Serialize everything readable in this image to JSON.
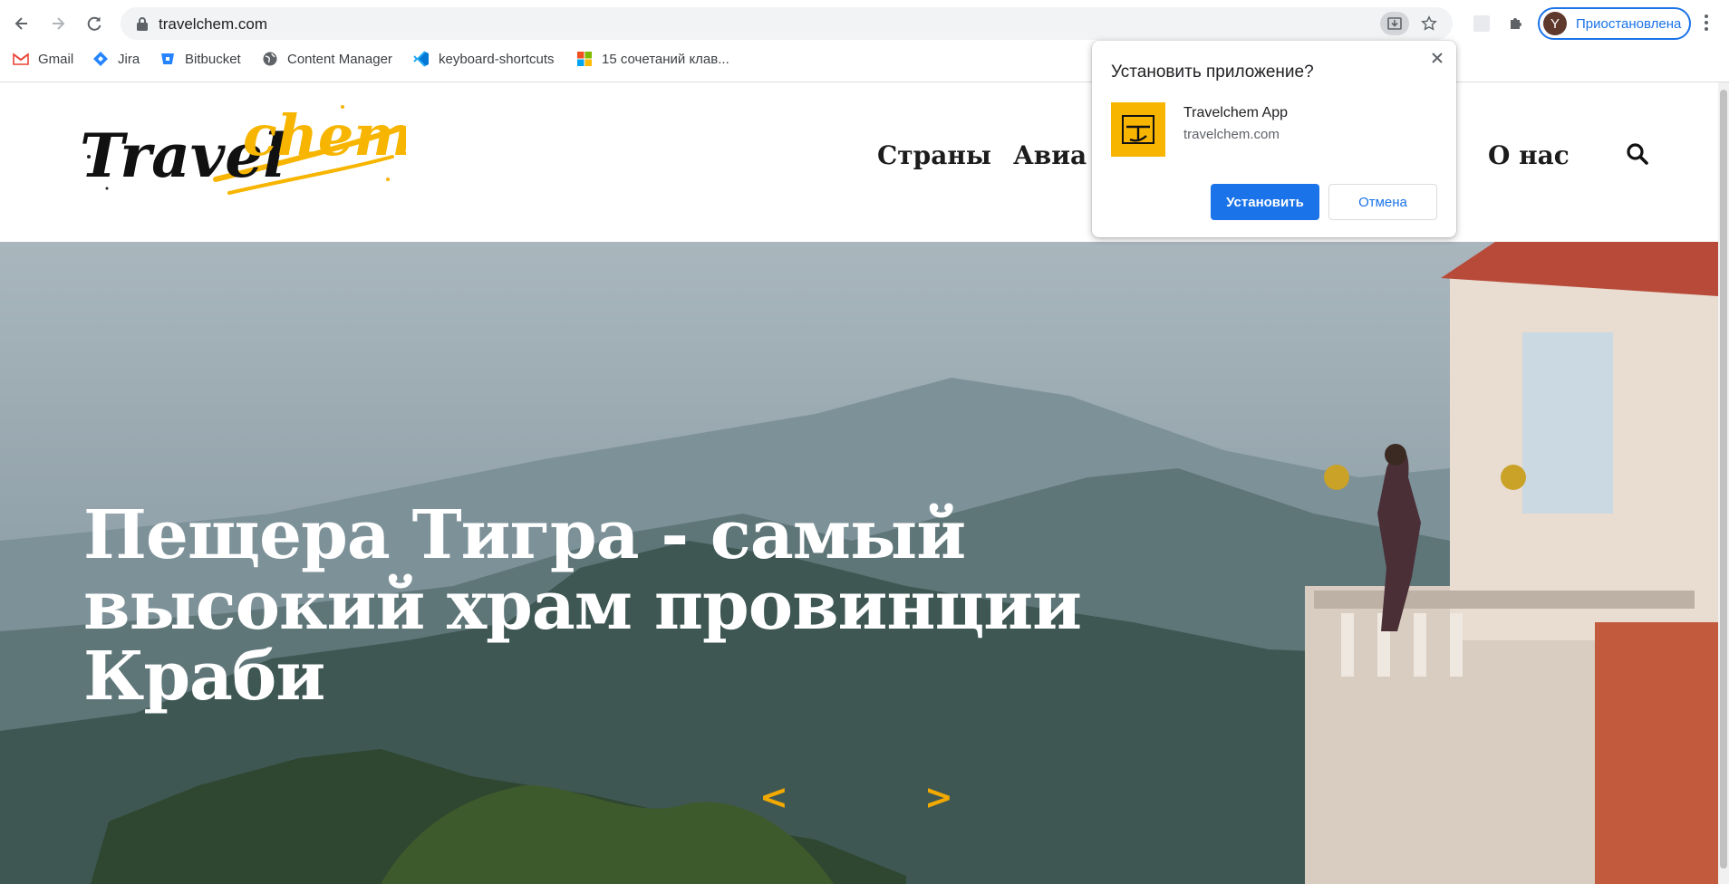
{
  "browser": {
    "url": "travelchem.com",
    "profile_initial": "Y",
    "profile_label": "Приостановлена",
    "bookmarks": [
      {
        "label": "Gmail",
        "icon": "gmail-icon"
      },
      {
        "label": "Jira",
        "icon": "jira-icon"
      },
      {
        "label": "Bitbucket",
        "icon": "bitbucket-icon"
      },
      {
        "label": "Content Manager",
        "icon": "globe-icon"
      },
      {
        "label": "keyboard-shortcuts",
        "icon": "vscode-icon"
      },
      {
        "label": "15 сочетаний клав...",
        "icon": "windows-icon"
      }
    ]
  },
  "site": {
    "logo_text_black": "Travel",
    "logo_text_yellow": "chem",
    "nav": [
      "Страны",
      "Авиа",
      "О нас"
    ],
    "hero_title": "Пещера Тигра - самый высокий храм провинции Краби",
    "prev_arrow": "<",
    "next_arrow": ">"
  },
  "install_popup": {
    "title": "Установить приложение?",
    "app_name": "Travelchem App",
    "app_host": "travelchem.com",
    "install_label": "Установить",
    "cancel_label": "Отмена"
  },
  "colors": {
    "accent": "#1a73e8",
    "brand_yellow": "#f7b500",
    "arrow_yellow": "#f2a900"
  }
}
